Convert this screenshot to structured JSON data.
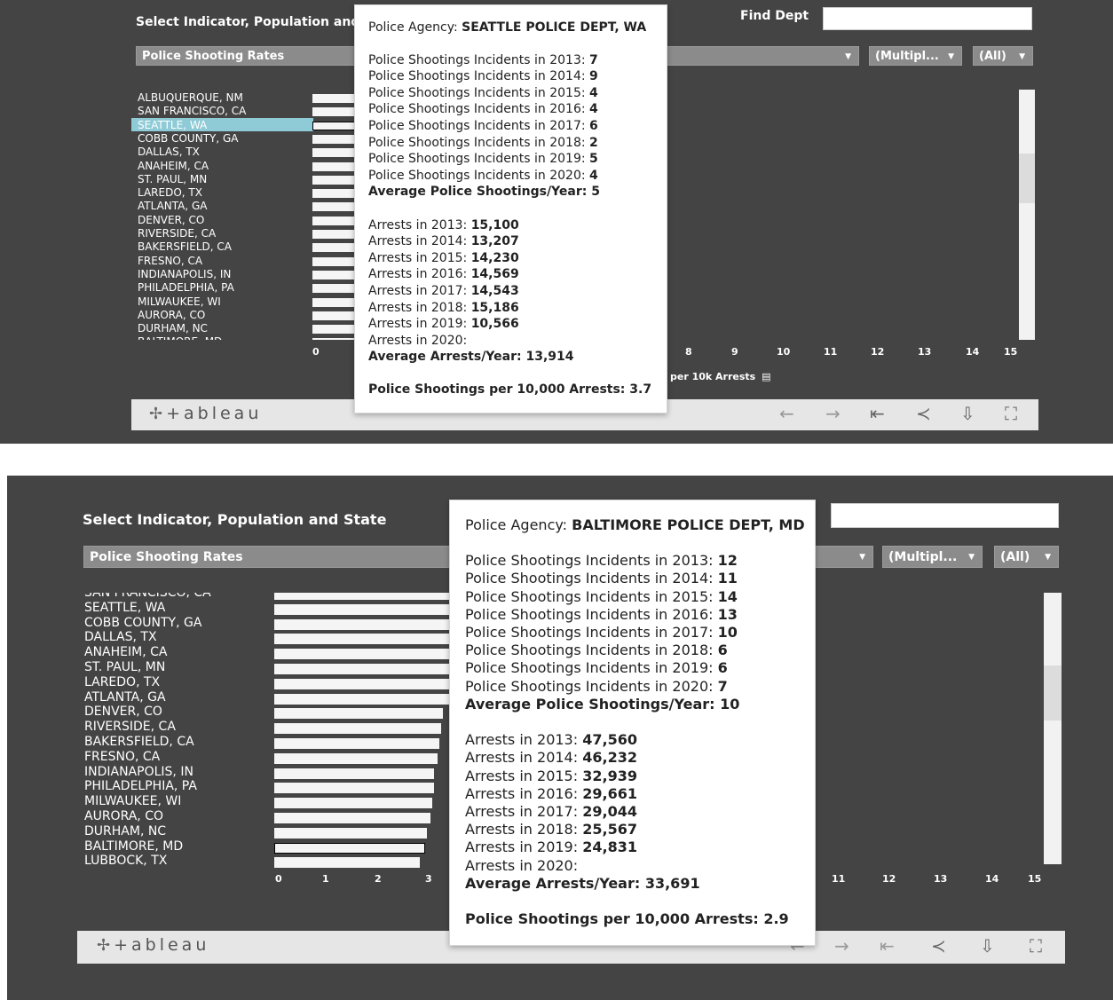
{
  "viz1": {
    "title": "Select Indicator, Population and",
    "find_dept_label": "Find Dept",
    "indicator_dropdown": "Police Shooting Rates",
    "multiple_dropdown": "(Multipl...",
    "all_dropdown": "(All)",
    "categories": [
      "ALBUQUERQUE, NM",
      "SAN FRANCISCO, CA",
      "SEATTLE, WA",
      "COBB COUNTY, GA",
      "DALLAS, TX",
      "ANAHEIM, CA",
      "ST. PAUL, MN",
      "LAREDO, TX",
      "ATLANTA, GA",
      "DENVER, CO",
      "RIVERSIDE, CA",
      "BAKERSFIELD, CA",
      "FRESNO, CA",
      "INDIANAPOLIS, IN",
      "PHILADELPHIA, PA",
      "MILWAUKEE, WI",
      "AURORA, CO",
      "DURHAM, NC",
      "BALTIMORE, MD"
    ],
    "selected_category": "SEATTLE, WA",
    "x_ticks": [
      "0",
      "8",
      "9",
      "10",
      "11",
      "12",
      "13",
      "14",
      "15"
    ],
    "axis_label": "per 10k Arrests",
    "tooltip": {
      "agency_prefix": "Police Agency: ",
      "agency": "SEATTLE POLICE DEPT, WA",
      "shootings": [
        {
          "label": "Police Shootings Incidents in 2013: ",
          "value": "7"
        },
        {
          "label": "Police Shootings Incidents in 2014: ",
          "value": "9"
        },
        {
          "label": "Police Shootings Incidents in 2015: ",
          "value": "4"
        },
        {
          "label": "Police Shootings Incidents in 2016: ",
          "value": "4"
        },
        {
          "label": "Police Shootings Incidents in 2017: ",
          "value": "6"
        },
        {
          "label": "Police Shootings Incidents in 2018: ",
          "value": "2"
        },
        {
          "label": "Police Shootings Incidents in 2019: ",
          "value": "5"
        },
        {
          "label": "Police Shootings Incidents in 2020: ",
          "value": "4"
        }
      ],
      "avg_shootings": "Average Police Shootings/Year: 5",
      "arrests": [
        {
          "label": "Arrests in 2013: ",
          "value": "15,100"
        },
        {
          "label": "Arrests in 2014: ",
          "value": "13,207"
        },
        {
          "label": "Arrests in 2015: ",
          "value": "14,230"
        },
        {
          "label": "Arrests in 2016: ",
          "value": "14,569"
        },
        {
          "label": "Arrests in 2017: ",
          "value": "14,543"
        },
        {
          "label": "Arrests in 2018: ",
          "value": "15,186"
        },
        {
          "label": "Arrests in 2019: ",
          "value": "10,566"
        },
        {
          "label": "Arrests in 2020: ",
          "value": ""
        }
      ],
      "avg_arrests": "Average Arrests/Year: 13,914",
      "rate": "Police Shootings per 10,000 Arrests: 3.7"
    }
  },
  "viz2": {
    "title": "Select Indicator, Population and State",
    "indicator_dropdown": "Police Shooting Rates",
    "multiple_dropdown": "(Multipl...",
    "all_dropdown": "(All)",
    "categories": [
      "SAN FRANCISCO, CA",
      "SEATTLE, WA",
      "COBB COUNTY, GA",
      "DALLAS, TX",
      "ANAHEIM, CA",
      "ST. PAUL, MN",
      "LAREDO, TX",
      "ATLANTA, GA",
      "DENVER, CO",
      "RIVERSIDE, CA",
      "BAKERSFIELD, CA",
      "FRESNO, CA",
      "INDIANAPOLIS, IN",
      "PHILADELPHIA, PA",
      "MILWAUKEE, WI",
      "AURORA, CO",
      "DURHAM, NC",
      "BALTIMORE, MD",
      "LUBBOCK, TX"
    ],
    "highlighted_category": "BALTIMORE, MD",
    "x_ticks": [
      "0",
      "1",
      "2",
      "3",
      "11",
      "12",
      "13",
      "14",
      "15"
    ],
    "tooltip": {
      "agency_prefix": "Police Agency: ",
      "agency": "BALTIMORE POLICE DEPT, MD",
      "shootings": [
        {
          "label": "Police Shootings Incidents in 2013: ",
          "value": "12"
        },
        {
          "label": "Police Shootings Incidents in 2014: ",
          "value": "11"
        },
        {
          "label": "Police Shootings Incidents in 2015: ",
          "value": "14"
        },
        {
          "label": "Police Shootings Incidents in 2016: ",
          "value": "13"
        },
        {
          "label": "Police Shootings Incidents in 2017: ",
          "value": "10"
        },
        {
          "label": "Police Shootings Incidents in 2018: ",
          "value": "6"
        },
        {
          "label": "Police Shootings Incidents in 2019: ",
          "value": "6"
        },
        {
          "label": "Police Shootings Incidents in 2020: ",
          "value": "7"
        }
      ],
      "avg_shootings": "Average Police Shootings/Year: 10",
      "arrests": [
        {
          "label": "Arrests in 2013: ",
          "value": "47,560"
        },
        {
          "label": "Arrests in 2014: ",
          "value": "46,232"
        },
        {
          "label": "Arrests in 2015: ",
          "value": "32,939"
        },
        {
          "label": "Arrests in 2016: ",
          "value": "29,661"
        },
        {
          "label": "Arrests in 2017: ",
          "value": "29,044"
        },
        {
          "label": "Arrests in 2018: ",
          "value": "25,567"
        },
        {
          "label": "Arrests in 2019: ",
          "value": "24,831"
        },
        {
          "label": "Arrests in 2020: ",
          "value": ""
        }
      ],
      "avg_arrests": "Average Arrests/Year: 33,691",
      "rate": "Police Shootings per 10,000 Arrests: 2.9"
    }
  },
  "toolbar": {
    "logo_text": "+ableau",
    "icons": [
      "undo-icon",
      "redo-icon",
      "revert-icon",
      "share-icon",
      "download-icon",
      "fullscreen-icon"
    ]
  }
}
